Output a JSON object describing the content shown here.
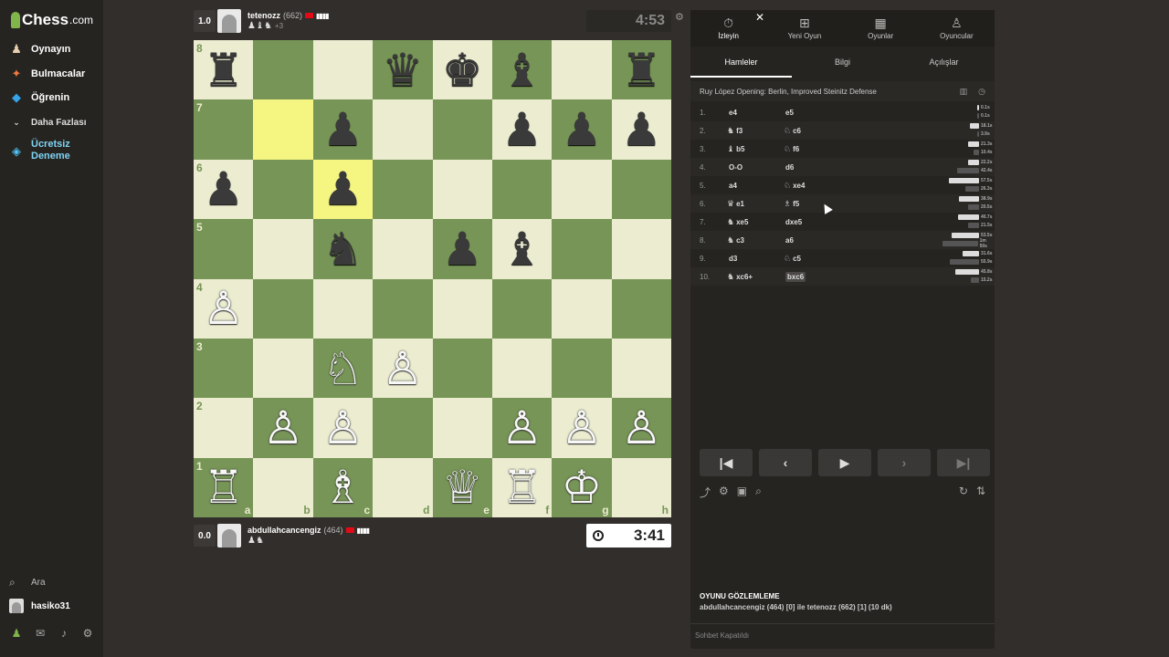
{
  "sidebar": {
    "logo": "Chess",
    "logo_suffix": ".com",
    "items": [
      {
        "label": "Oynayın",
        "icon": "play-pawn-icon"
      },
      {
        "label": "Bulmacalar",
        "icon": "puzzle-icon"
      },
      {
        "label": "Öğrenin",
        "icon": "graduation-cap-icon"
      },
      {
        "label": "Daha Fazlası",
        "icon": "chevron-down-icon"
      },
      {
        "label": "Ücretsiz Deneme",
        "icon": "diamond-icon"
      }
    ],
    "search_label": "Ara",
    "username": "hasiko31"
  },
  "players": {
    "top": {
      "score": "1.0",
      "name": "tetenozz",
      "rating": "(662)",
      "bars": "▮▮▮▮",
      "captured": "♟♝♞",
      "captured_extra": "+3",
      "clock": "4:53"
    },
    "bottom": {
      "score": "0.0",
      "name": "abdullahcancengiz",
      "rating": "(464)",
      "bars": "▮▮▮▮",
      "captured": "♟♞",
      "clock": "3:41"
    }
  },
  "board": {
    "ranks": [
      "8",
      "7",
      "6",
      "5",
      "4",
      "3",
      "2",
      "1"
    ],
    "files": [
      "a",
      "b",
      "c",
      "d",
      "e",
      "f",
      "g",
      "h"
    ],
    "position": [
      [
        "br",
        "",
        "",
        "bq",
        "bk",
        "bb",
        "",
        "br"
      ],
      [
        "",
        "",
        "bp",
        "",
        "",
        "bp",
        "bp",
        "bp"
      ],
      [
        "bp",
        "",
        "bp",
        "",
        "",
        "",
        "",
        ""
      ],
      [
        "",
        "",
        "bn",
        "",
        "bp",
        "bb",
        "",
        ""
      ],
      [
        "wp",
        "",
        "",
        "",
        "",
        "",
        "",
        ""
      ],
      [
        "",
        "",
        "wn",
        "wp",
        "",
        "",
        "",
        ""
      ],
      [
        "",
        "wp",
        "wp",
        "",
        "",
        "wp",
        "wp",
        "wp"
      ],
      [
        "wr",
        "",
        "wb",
        "",
        "wq",
        "wr",
        "wk",
        ""
      ]
    ],
    "highlights": [
      "b7",
      "c6"
    ]
  },
  "panel": {
    "tabs": [
      {
        "label": "İzleyin",
        "icon": "stopwatch-icon"
      },
      {
        "label": "Yeni Oyun",
        "icon": "plus-square-icon"
      },
      {
        "label": "Oyunlar",
        "icon": "board-icon"
      },
      {
        "label": "Oyuncular",
        "icon": "people-icon"
      }
    ],
    "subtabs": [
      "Hamleler",
      "Bilgi",
      "Açılışlar"
    ],
    "opening": "Ruy López Opening: Berlin, Improved Steinitz Defense",
    "moves": [
      {
        "num": "1.",
        "w_piece": "",
        "w": "e4",
        "b_piece": "",
        "b": "e5",
        "wt": "0.1s",
        "bt": "0.1s",
        "wf": 0.02,
        "bf": 0.02
      },
      {
        "num": "2.",
        "w_piece": "♞",
        "w": "f3",
        "b_piece": "♘",
        "b": "c6",
        "wt": "18.1s",
        "bt": "3.9s",
        "wf": 0.25,
        "bf": 0.05
      },
      {
        "num": "3.",
        "w_piece": "♝",
        "w": "b5",
        "b_piece": "♘",
        "b": "f6",
        "wt": "21.3s",
        "bt": "10.4s",
        "wf": 0.3,
        "bf": 0.15
      },
      {
        "num": "4.",
        "w_piece": "",
        "w": "O-O",
        "b_piece": "",
        "b": "d6",
        "wt": "22.2s",
        "bt": "42.4s",
        "wf": 0.31,
        "bf": 0.6
      },
      {
        "num": "5.",
        "w_piece": "",
        "w": "a4",
        "b_piece": "♘",
        "b": "xe4",
        "wt": "57.5s",
        "bt": "26.3s",
        "wf": 0.82,
        "bf": 0.37
      },
      {
        "num": "6.",
        "w_piece": "♛",
        "w": "e1",
        "b_piece": "♗",
        "b": "f5",
        "wt": "38.9s",
        "bt": "20.5s",
        "wf": 0.55,
        "bf": 0.29
      },
      {
        "num": "7.",
        "w_piece": "♞",
        "w": "xe5",
        "b_piece": "",
        "b": "dxe5",
        "wt": "40.7s",
        "bt": "21.5s",
        "wf": 0.58,
        "bf": 0.3
      },
      {
        "num": "8.",
        "w_piece": "♞",
        "w": "c3",
        "b_piece": "",
        "b": "a6",
        "wt": "53.5s",
        "bt": "1m 50s",
        "wf": 0.76,
        "bf": 1.0
      },
      {
        "num": "9.",
        "w_piece": "",
        "w": "d3",
        "b_piece": "♘",
        "b": "c5",
        "wt": "31.6s",
        "bt": "55.9s",
        "wf": 0.45,
        "bf": 0.8
      },
      {
        "num": "10.",
        "w_piece": "♞",
        "w": "xc6+",
        "b_piece": "",
        "b": "bxc6",
        "wt": "45.8s",
        "bt": "15.2s",
        "wf": 0.65,
        "bf": 0.22
      }
    ],
    "watch_title": "OYUNU GÖZLEMLEME",
    "watch_desc": "abdullahcancengiz (464) [0] ile tetenozz (662) [1] (10 dk)",
    "chat_status": "Sohbet Kapatıldı"
  }
}
